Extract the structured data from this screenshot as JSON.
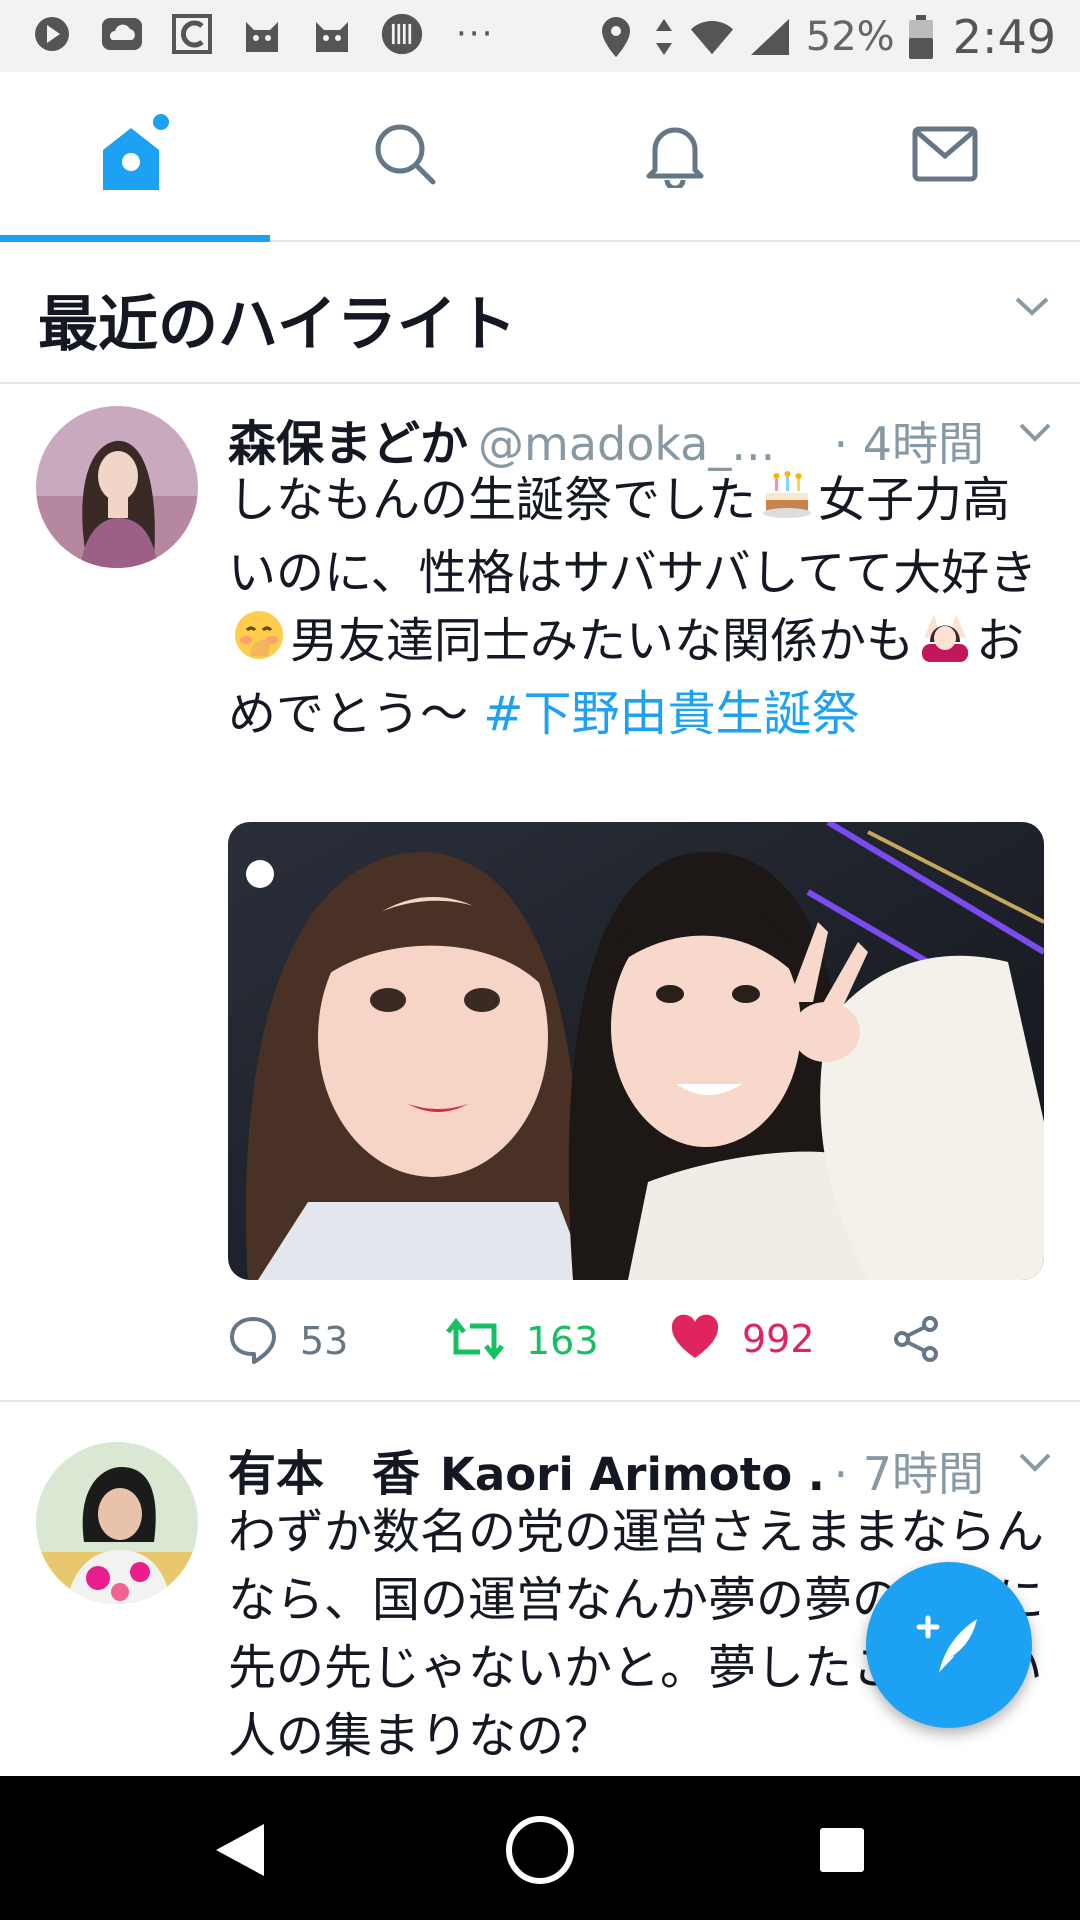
{
  "status_bar": {
    "battery_percent": "52%",
    "time": "2:49",
    "overflow": "···",
    "left_icons": [
      "play-icon",
      "cloud-icon",
      "c-app-icon",
      "cat-icon",
      "cat-icon",
      "barcode-icon"
    ],
    "right_icons": [
      "location-icon",
      "data-arrows-icon",
      "wifi-icon",
      "signal-icon",
      "battery-icon"
    ]
  },
  "tabs": [
    {
      "name": "home",
      "icon": "home-icon",
      "active": true
    },
    {
      "name": "search",
      "icon": "search-icon",
      "active": false
    },
    {
      "name": "notifications",
      "icon": "bell-icon",
      "active": false
    },
    {
      "name": "messages",
      "icon": "mail-icon",
      "active": false
    }
  ],
  "section": {
    "title": "最近のハイライト"
  },
  "tweets": [
    {
      "display_name": "森保まどか",
      "handle": "@madoka_...",
      "time": "· 4時間",
      "text_1": "しなもんの生誕祭でした",
      "text_2": "女子力高いのに、性格はサバサバしてて大好き",
      "text_3": "男友達同士みたいな関係かも",
      "text_4": "おめでとう〜 ",
      "hashtag": "#下野由貴生誕祭",
      "media": true,
      "reply_count": "53",
      "retweet_count": "163",
      "like_count": "992"
    },
    {
      "display_name": "有本　香",
      "display_name_en": "Kaori Arimoto ...",
      "time": "· 7時間",
      "text": "わずか数名の党の運営さえままならんなら、国の運営なんか夢の夢のさらに先の先じゃないかと。夢したことない人の集まりなの？"
    }
  ],
  "colors": {
    "accent": "#1da1f2",
    "retweet": "#17bf63",
    "like": "#e0245e",
    "muted": "#8899a6"
  }
}
